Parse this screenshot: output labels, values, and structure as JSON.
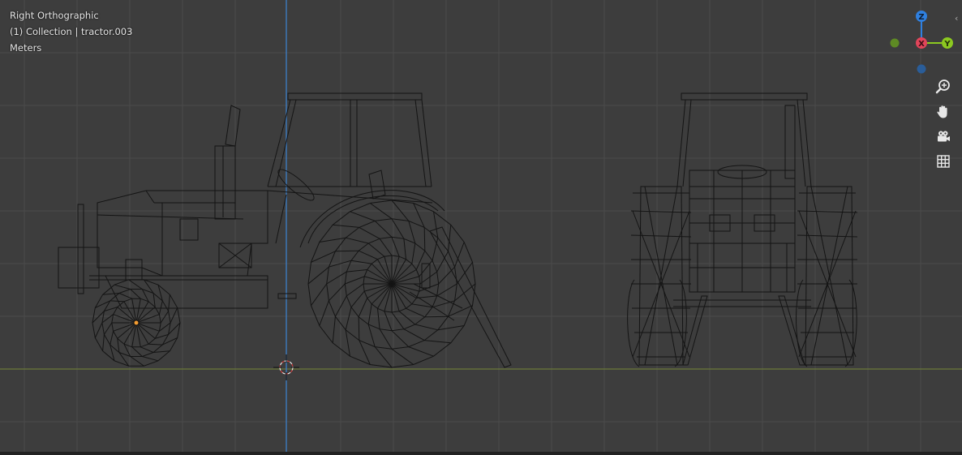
{
  "viewport": {
    "view_name": "Right Orthographic",
    "collection_label": "(1) Collection | tractor.003",
    "units": "Meters"
  },
  "gizmo": {
    "z_label": "Z",
    "x_label": "X",
    "y_label": "Y",
    "colors": {
      "z": "#2f80e0",
      "x": "#e0455a",
      "y": "#8cc920",
      "neg_y": "#5e8a24",
      "neg_z": "#2a5d99"
    }
  },
  "nav_buttons": [
    {
      "name": "zoom-icon"
    },
    {
      "name": "hand-pan-icon"
    },
    {
      "name": "camera-icon"
    },
    {
      "name": "grid-icon"
    }
  ],
  "colors": {
    "background": "#3d3d3d",
    "grid_line": "#4a4a4a",
    "wire": "#111111",
    "z_axis_line": "#3d7fc9",
    "ground_line": "#6b7a3a"
  }
}
